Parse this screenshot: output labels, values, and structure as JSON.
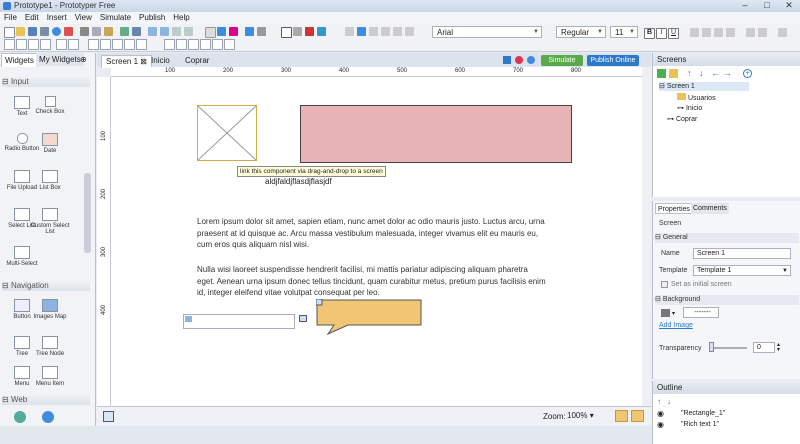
{
  "window": {
    "title": "Prototype1 - Prototyper Free"
  },
  "menu": [
    "File",
    "Edit",
    "Insert",
    "View",
    "Simulate",
    "Publish",
    "Help"
  ],
  "toolbar": {
    "font": "Arial",
    "style": "Regular",
    "size": "11"
  },
  "left_panel": {
    "tabs": [
      "Widgets",
      "My Widgets"
    ],
    "input_header": "Input",
    "input_widgets": [
      "Text",
      "Check Box",
      "Radio Button",
      "Date",
      "File Upload",
      "List Box",
      "Select List",
      "Custom Select List",
      "Multi-Select"
    ],
    "navigation_header": "Navigation",
    "navigation_widgets": [
      "Button",
      "Images Map",
      "Tree",
      "Tree Node",
      "Menu",
      "Menu Item"
    ],
    "web_header": "Web"
  },
  "doc_tabs": [
    "Screen 1",
    "Inicio",
    "Coprar"
  ],
  "actions": {
    "simulate": "Simulate",
    "publish": "Publish Online"
  },
  "ruler": {
    "h": [
      "100",
      "200",
      "300",
      "400",
      "500",
      "600",
      "700",
      "800"
    ],
    "v": [
      "100",
      "200",
      "300",
      "400"
    ]
  },
  "canvas": {
    "tooltip": "link this component via drag-and-drop to a screen",
    "label_text": "aldjfaldjflasdjflasjdf",
    "para1": "Lorem ipsum dolor sit amet, sapien etiam, nunc amet dolor ac odio mauris justo. Luctus arcu, urna praesent at id quisque ac. Arcu massa vestibulum malesuada, integer vivamus elit eu mauris eu, cum eros quis aliquam nisl wisi.",
    "para2": "Nulla wisi laoreet suspendisse hendrerit facilisi, mi mattis pariatur adipiscing aliquam pharetra eget. Aenean urna ipsum donec tellus tincidunt, quam curabitur metus, pretium purus facilisis enim id, integer eleifend vitae volutpat consequat per leo.",
    "rectangle_color": "#e8b4b8",
    "callout_color": "#f0c674"
  },
  "bottom": {
    "zoom_label": "Zoom:",
    "zoom_value": "100%"
  },
  "screens_panel": {
    "title": "Screens",
    "tree": [
      "Screen 1",
      "Usuarios",
      "Inicio",
      "Coprar"
    ]
  },
  "properties_panel": {
    "tabs": [
      "Properties",
      "Comments"
    ],
    "section": "Screen",
    "general": "General",
    "name_label": "Name",
    "name_value": "Screen 1",
    "template_label": "Template",
    "template_value": "Template 1",
    "initial_screen": "Set as initial screen",
    "background": "Background",
    "color_value": "-------",
    "add_image": "Add Image",
    "transparency_label": "Transparency",
    "transparency_value": "0"
  },
  "outline_panel": {
    "title": "Outline",
    "items": [
      "\"Rectangle_1\"",
      "\"Rich text 1\""
    ]
  }
}
